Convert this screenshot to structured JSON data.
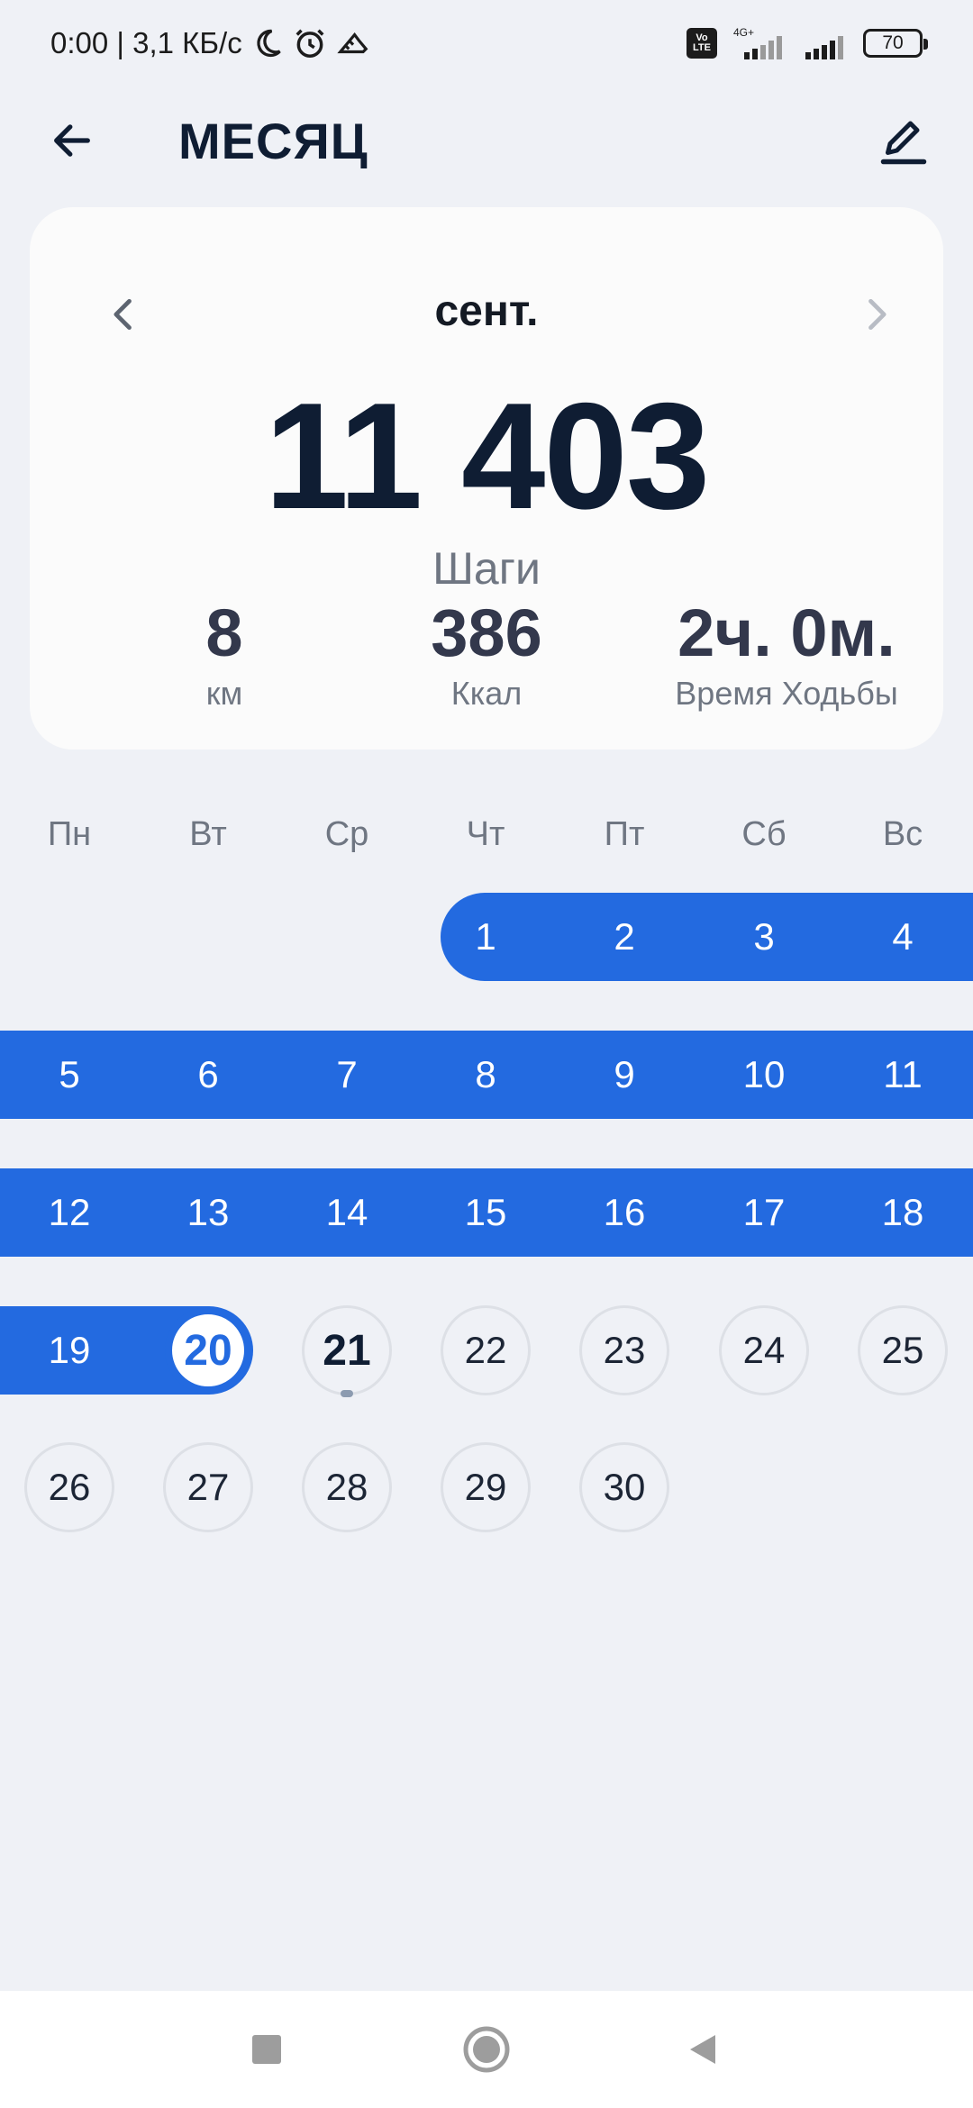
{
  "status_bar": {
    "left_text": "0:00 | 3,1 КБ/с",
    "network_badge": "Vo LTE",
    "network_type": "4G+",
    "battery": "70",
    "icons": [
      "moon-icon",
      "alarm-icon",
      "shoe-icon",
      "signal-icon",
      "signal-icon-2"
    ]
  },
  "app_bar": {
    "title": "МЕСЯЦ",
    "back_icon": "arrow-left-icon",
    "edit_icon": "pencil-icon"
  },
  "summary": {
    "month": "сент.",
    "steps": "11 403",
    "steps_label": "Шаги",
    "distance_value": "8",
    "distance_label": "км",
    "kcal_value": "386",
    "kcal_label": "Ккал",
    "time_value": "2ч. 0м.",
    "time_label": "Время Ходьбы"
  },
  "calendar": {
    "weekdays": [
      "Пн",
      "Вт",
      "Ср",
      "Чт",
      "Пт",
      "Сб",
      "Вс"
    ],
    "first_weekday_index": 3,
    "days_in_month": 30,
    "goal_reached_through_day": 20,
    "selected_day": 20,
    "current_day": 21,
    "accent_color": "#236ae0"
  },
  "nav_bar": {
    "icons": [
      "square-recents-icon",
      "circle-home-icon",
      "triangle-back-icon"
    ]
  }
}
